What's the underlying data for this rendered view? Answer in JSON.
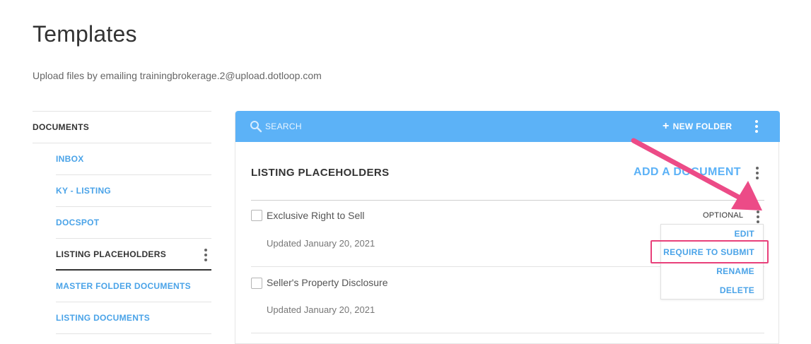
{
  "page": {
    "title": "Templates",
    "subtitle": "Upload files by emailing trainingbrokerage.2@upload.dotloop.com"
  },
  "sidebar": {
    "root_label": "DOCUMENTS",
    "items": [
      {
        "label": "INBOX"
      },
      {
        "label": "KY - LISTING"
      },
      {
        "label": "DOCSPOT"
      },
      {
        "label": "LISTING PLACEHOLDERS"
      },
      {
        "label": "MASTER FOLDER DOCUMENTS"
      },
      {
        "label": "LISTING DOCUMENTS"
      }
    ],
    "active_index": 3
  },
  "toolbar": {
    "search_placeholder": "SEARCH",
    "search_icon": "search-icon",
    "new_folder_label": "NEW FOLDER",
    "new_folder_icon": "+"
  },
  "section": {
    "title": "LISTING PLACEHOLDERS",
    "add_document_label": "ADD A DOCUMENT"
  },
  "documents": [
    {
      "name": "Exclusive Right to Sell",
      "updated": "Updated January 20, 2021",
      "tag": "OPTIONAL"
    },
    {
      "name": "Seller's Property Disclosure",
      "updated": "Updated January 20, 2021",
      "tag": ""
    }
  ],
  "menu": {
    "items": [
      {
        "label": "EDIT"
      },
      {
        "label": "REQUIRE TO SUBMIT"
      },
      {
        "label": "RENAME"
      },
      {
        "label": "DELETE"
      }
    ],
    "highlighted_index": 1
  },
  "colors": {
    "toolbar": "#5cb2f7",
    "link": "#4aa3e8",
    "annotation": "#e8407a"
  }
}
